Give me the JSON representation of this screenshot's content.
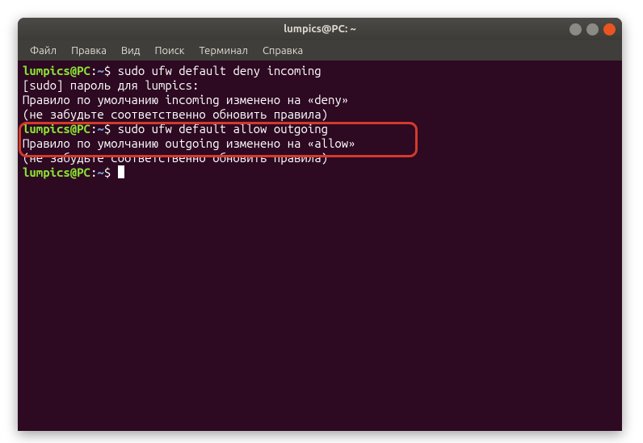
{
  "window": {
    "title": "lumpics@PC: ~"
  },
  "menubar": {
    "file": "Файл",
    "edit": "Правка",
    "view": "Вид",
    "search": "Поиск",
    "terminal": "Терминал",
    "help": "Справка"
  },
  "prompt": {
    "userhost": "lumpics@PC",
    "sep": ":",
    "path": "~",
    "dollar": "$ "
  },
  "lines": {
    "cmd1": "sudo ufw default deny incoming",
    "out1": "[sudo] пароль для lumpics:",
    "out2": "Правило по умолчанию incoming изменено на «deny»",
    "out3": "(не забудьте соответственно обновить правила)",
    "cmd2": "sudo ufw default allow outgoing",
    "out4": "Правило по умолчанию outgoing изменено на «allow»",
    "out5": "(не забудьте соответственно обновить правила)"
  }
}
